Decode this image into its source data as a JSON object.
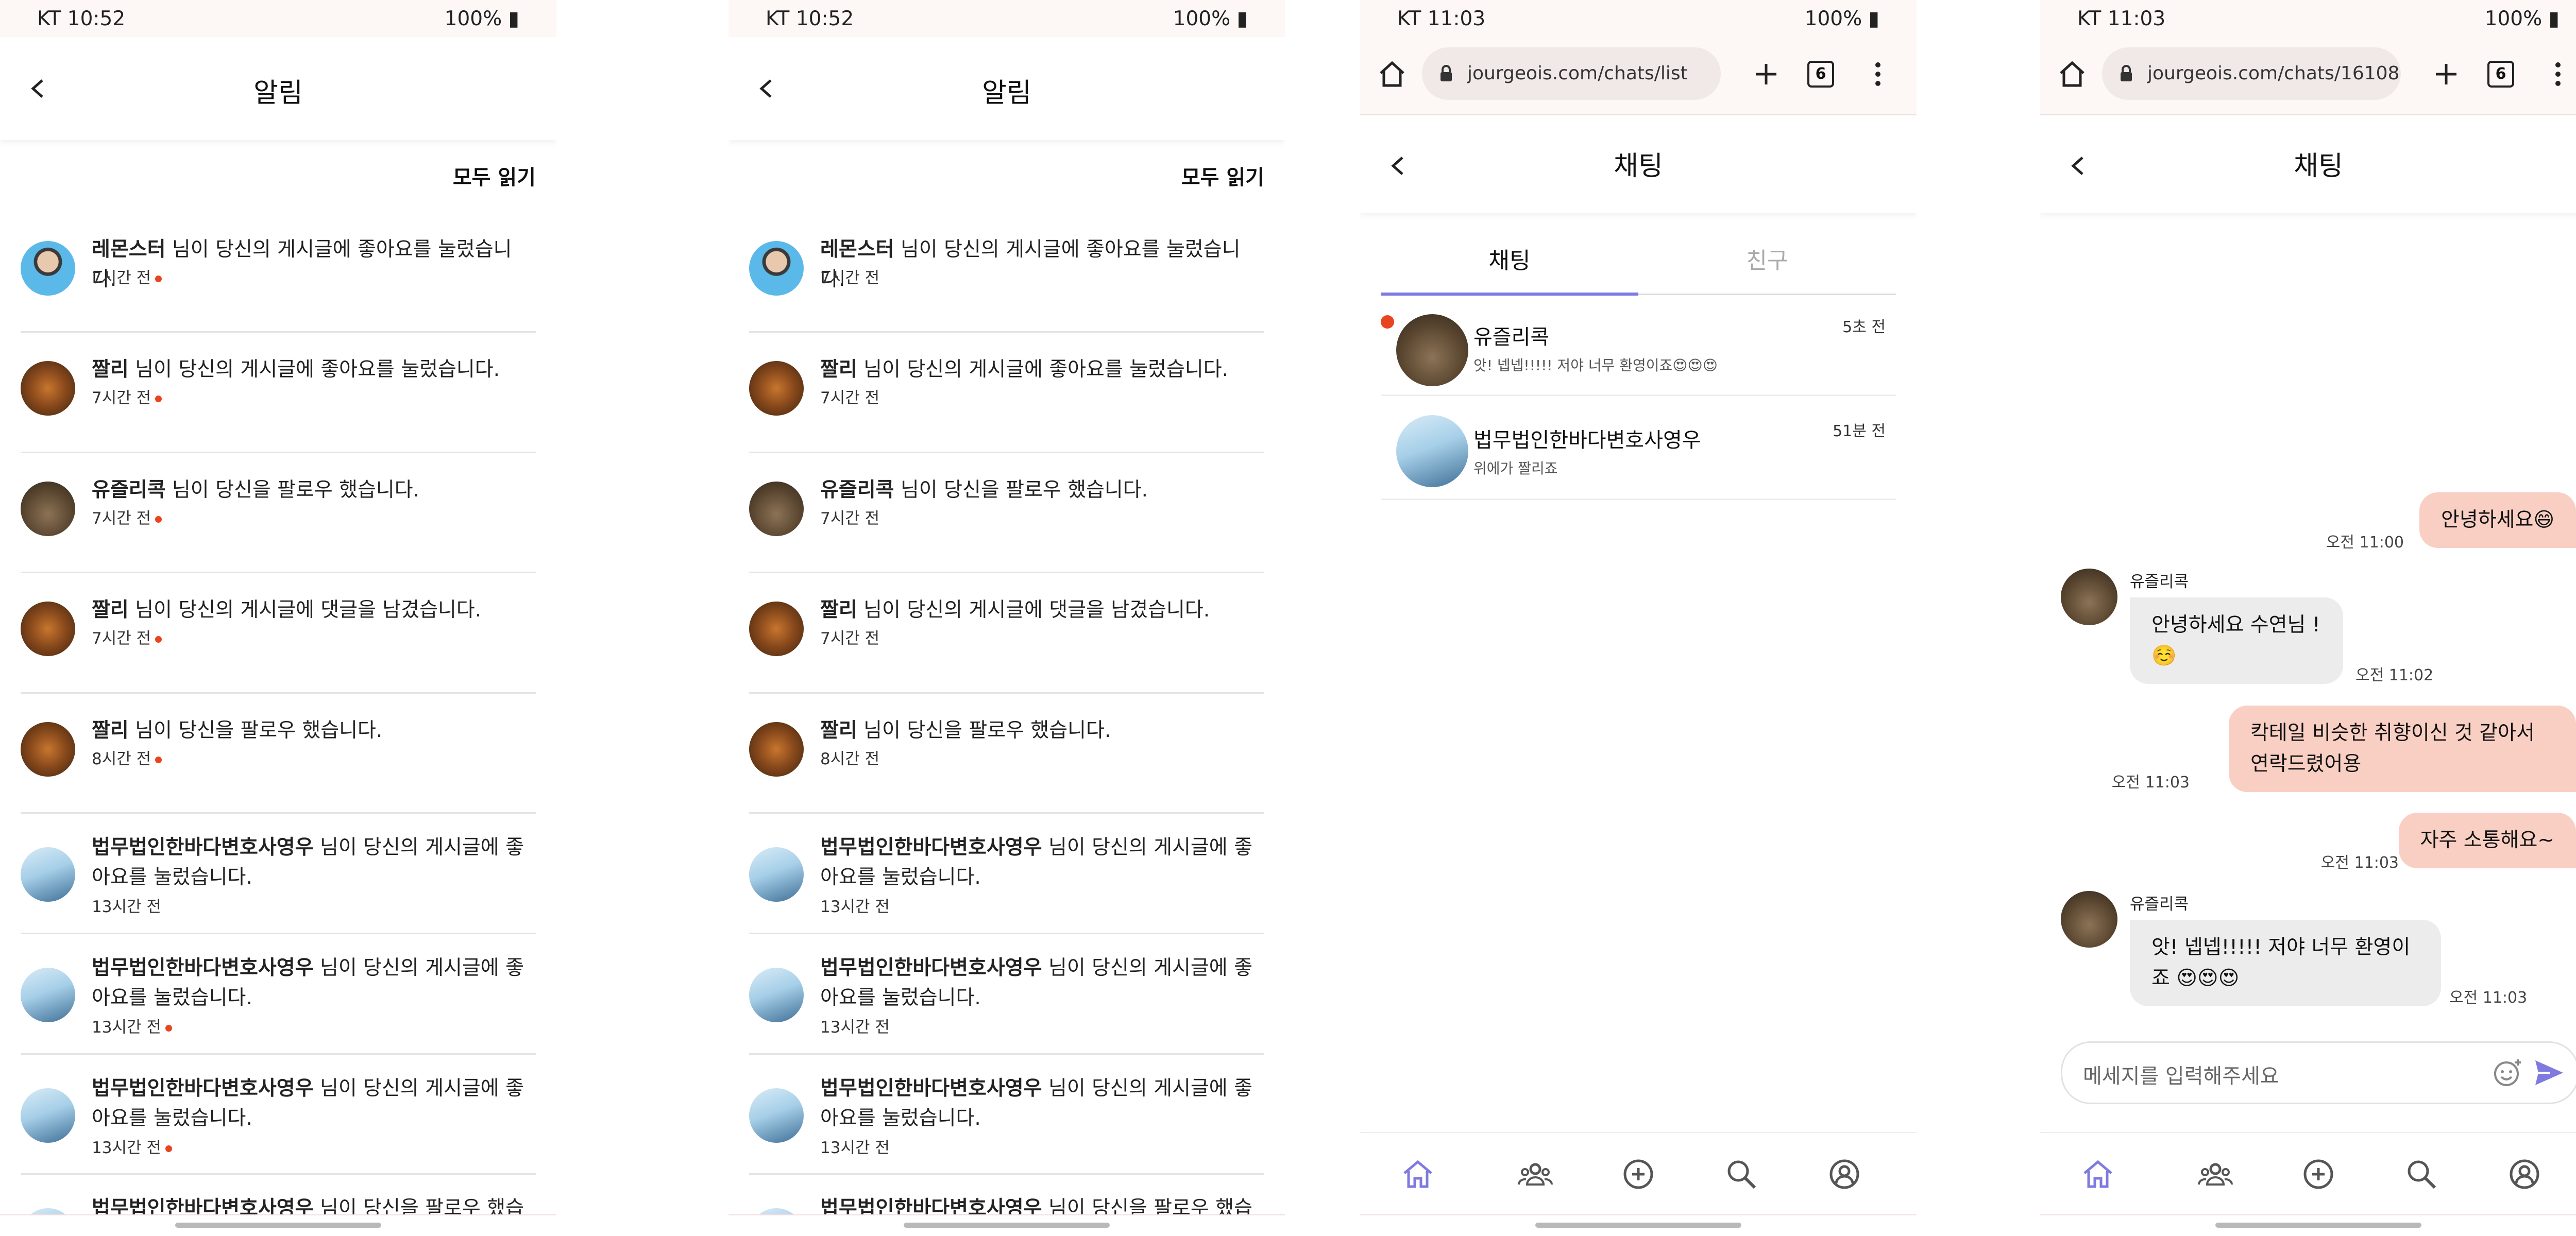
{
  "status_bars": [
    {
      "carrier": "KT",
      "time": "10:52",
      "battery": "100%"
    },
    {
      "carrier": "KT",
      "time": "10:52",
      "battery": "100%"
    },
    {
      "carrier": "KT",
      "time": "11:03",
      "battery": "100%"
    },
    {
      "carrier": "KT",
      "time": "11:03",
      "battery": "100%"
    }
  ],
  "notifications_screen": {
    "title": "알림",
    "read_all": "모두 읽기",
    "items": [
      {
        "name": "레몬스터",
        "message": " 님이 당신의 게시글에 좋아요를 눌렀습니다.",
        "time": "7시간 전",
        "avatar": "person"
      },
      {
        "name": "짤리",
        "message": " 님이 당신의 게시글에 좋아요를 눌렀습니다.",
        "time": "7시간 전",
        "avatar": "books"
      },
      {
        "name": "유즐리콕",
        "message": " 님이 당신을 팔로우 했습니다.",
        "time": "7시간 전",
        "avatar": "crowd"
      },
      {
        "name": "짤리",
        "message": " 님이 당신의 게시글에 댓글을 남겼습니다.",
        "time": "7시간 전",
        "avatar": "books"
      },
      {
        "name": "짤리",
        "message": " 님이 당신을 팔로우 했습니다.",
        "time": "8시간 전",
        "avatar": "books"
      },
      {
        "name": "법무법인한바다변호사영우",
        "message": " 님이 당신의 게시글에 좋아요를 눌렀습니다.",
        "time": "13시간 전",
        "avatar": "whale"
      },
      {
        "name": "법무법인한바다변호사영우",
        "message": " 님이 당신의 게시글에 좋아요를 눌렀습니다.",
        "time": "13시간 전",
        "avatar": "whale"
      },
      {
        "name": "법무법인한바다변호사영우",
        "message": " 님이 당신의 게시글에 좋아요를 눌렀습니다.",
        "time": "13시간 전",
        "avatar": "whale"
      },
      {
        "name": "법무법인한바다변호사영우",
        "message": " 님이 당신을 팔로우 했습니다.",
        "time": "",
        "avatar": "whale"
      }
    ],
    "unread_phone1": [
      true,
      true,
      true,
      true,
      true,
      false,
      true,
      true,
      false
    ],
    "unread_phone2": [
      false,
      false,
      false,
      false,
      false,
      false,
      false,
      false,
      false
    ]
  },
  "chat_list_screen": {
    "url": "jourgeois.com/chats/list",
    "tab_count": "6",
    "title": "채팅",
    "tabs": [
      "채팅",
      "친구"
    ],
    "rows": [
      {
        "name": "유즐리콕",
        "last": "앗! 넵넵!!!!! 저야 너무 환영이죠😍😍😍",
        "time": "5초 전",
        "unread": true,
        "avatar": "crowd"
      },
      {
        "name": "법무법인한바다변호사영우",
        "last": "위에가 짤리죠",
        "time": "51분 전",
        "unread": false,
        "avatar": "whale"
      }
    ]
  },
  "chat_room_screen": {
    "url": "jourgeois.com/chats/16108",
    "tab_count": "6",
    "title": "채팅",
    "messages": [
      {
        "from": "me",
        "text": "안녕하세요😄",
        "time": "오전 11:00"
      },
      {
        "from": "them",
        "sender": "유즐리콕",
        "text": "안녕하세요 수연님 ! ☺️",
        "time": "오전 11:02"
      },
      {
        "from": "me",
        "text": "칵테일 비슷한 취향이신 것 같아서 연락드렸어용",
        "time": "오전 11:03"
      },
      {
        "from": "me",
        "text": "자주 소통해요~",
        "time": "오전 11:03"
      },
      {
        "from": "them",
        "sender": "유즐리콕",
        "text": "앗! 넵넵!!!!! 저야 너무 환영이죠 😍😍😍",
        "time": "오전 11:03"
      }
    ],
    "input_placeholder": "메세지를 입력해주세요"
  },
  "colors": {
    "accent": "#7f7ae0",
    "unread_dot": "#e8441f",
    "my_bubble": "#f8cfc2",
    "their_bubble": "#ececec"
  },
  "bottom_nav_icons": [
    "home-icon",
    "friends-icon",
    "add-icon",
    "search-icon",
    "profile-icon"
  ]
}
